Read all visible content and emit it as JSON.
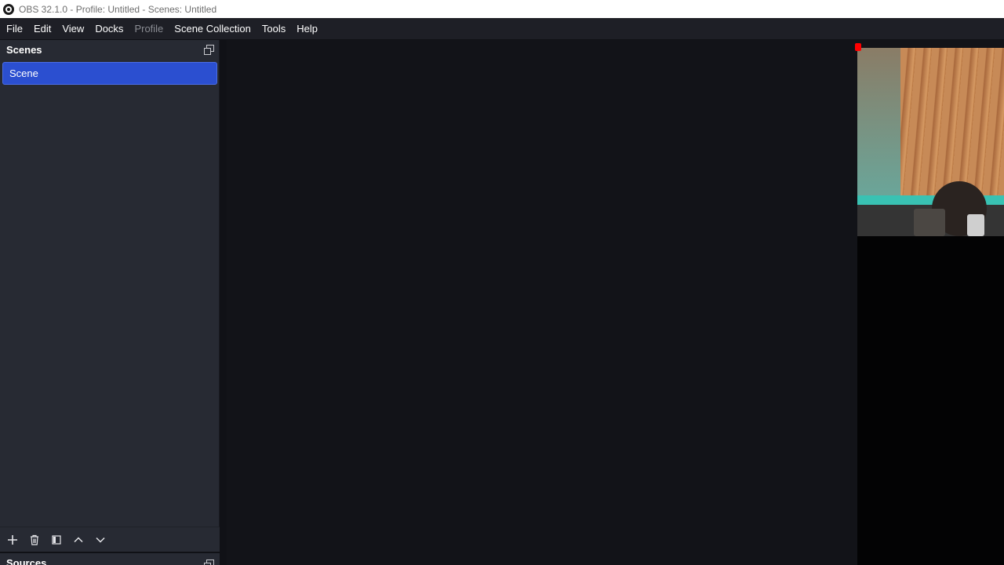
{
  "window": {
    "title": "OBS 32.1.0 - Profile: Untitled - Scenes: Untitled"
  },
  "menu": {
    "items": [
      "File",
      "Edit",
      "View",
      "Docks",
      "Profile",
      "Scene Collection",
      "Tools",
      "Help"
    ],
    "disabled": [
      "Profile"
    ]
  },
  "scenes_dock": {
    "title": "Scenes",
    "items": [
      {
        "label": "Scene",
        "selected": true
      }
    ],
    "toolbar": {
      "add_icon": "plus-icon",
      "remove_icon": "trash-icon",
      "filters_icon": "filter-icon",
      "up_icon": "chevron-up-icon",
      "down_icon": "chevron-down-icon"
    }
  },
  "sources_dock": {
    "title": "Sources"
  },
  "colors": {
    "selection": "#2b4fd0",
    "dock_bg": "#272a33",
    "preview_bg": "#121318",
    "handle": "#ff0000"
  }
}
